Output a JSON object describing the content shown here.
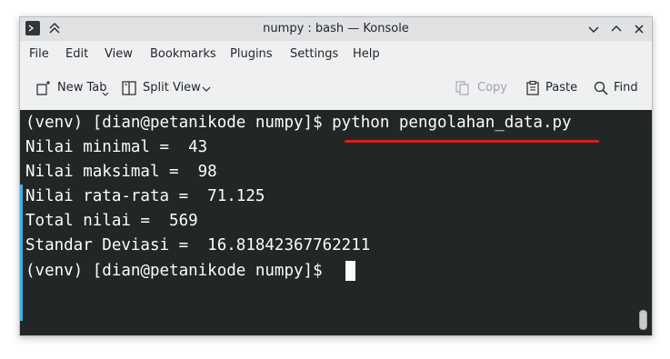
{
  "window": {
    "title": "numpy : bash — Konsole"
  },
  "menu": {
    "items": [
      "File",
      "Edit",
      "View",
      "Bookmarks",
      "Plugins",
      "Settings",
      "Help"
    ]
  },
  "toolbar": {
    "new_tab": "New Tab",
    "split_view": "Split View",
    "copy": "Copy",
    "paste": "Paste",
    "find": "Find"
  },
  "terminal": {
    "lines": [
      "(venv) [dian@petanikode numpy]$ python pengolahan_data.py",
      "Nilai minimal =  43",
      "Nilai maksimal =  98",
      "Nilai rata-rata =  71.125",
      "Total nilai =  569",
      "Standar Deviasi =  16.81842367762211",
      "(venv) [dian@petanikode numpy]$ "
    ]
  },
  "colors": {
    "terminal_bg": "#232627",
    "terminal_fg": "#fcfcfc",
    "highlight_underline": "#d41f1f",
    "focus_accent": "#3daee9"
  }
}
